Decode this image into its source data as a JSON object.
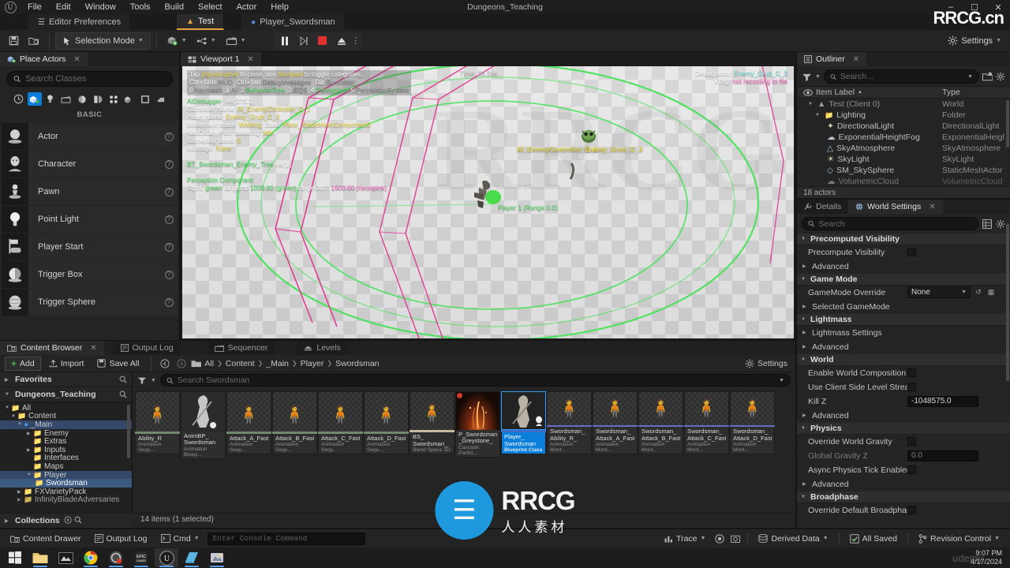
{
  "titlebar": {
    "menu": [
      "File",
      "Edit",
      "Window",
      "Tools",
      "Build",
      "Select",
      "Actor",
      "Help"
    ],
    "project_title": "Dungeons_Teaching",
    "minimize": "–",
    "maximize": "☐",
    "close": "✕"
  },
  "doctabs": [
    {
      "label": "Editor Preferences",
      "icon": "sliders-icon",
      "active": false
    },
    {
      "label": "Test",
      "icon": "level-icon",
      "active": true
    },
    {
      "label": "Player_Swordsman",
      "icon": "blueprint-icon",
      "active": false
    }
  ],
  "toolbar": {
    "save_label": "Save",
    "selection_mode": "Selection Mode",
    "settings": "Settings",
    "items": [
      {
        "name": "save-icon",
        "glyph": "💾"
      },
      {
        "name": "content-icon",
        "glyph": "🗀"
      }
    ]
  },
  "place_actors": {
    "tab_label": "Place Actors",
    "search_placeholder": "Search Classes",
    "categories": [
      {
        "name": "recently-placed-icon",
        "active": false
      },
      {
        "name": "basic-icon",
        "active": true
      },
      {
        "name": "lights-icon",
        "active": false
      },
      {
        "name": "cinematic-icon",
        "active": false
      },
      {
        "name": "visual-effects-icon",
        "active": false
      },
      {
        "name": "geometry-icon",
        "active": false
      },
      {
        "name": "volumes-icon",
        "active": false
      },
      {
        "name": "all-classes-icon",
        "active": false
      },
      {
        "name": "shapes-icon",
        "active": false
      },
      {
        "name": "misc-icon",
        "active": false
      }
    ],
    "section_label": "BASIC",
    "actors": [
      {
        "label": "Actor",
        "icon": "actor-icon"
      },
      {
        "label": "Character",
        "icon": "character-icon"
      },
      {
        "label": "Pawn",
        "icon": "pawn-icon"
      },
      {
        "label": "Point Light",
        "icon": "point-light-icon"
      },
      {
        "label": "Player Start",
        "icon": "player-start-icon"
      },
      {
        "label": "Trigger Box",
        "icon": "trigger-box-icon"
      },
      {
        "label": "Trigger Sphere",
        "icon": "trigger-sphere-icon"
      }
    ],
    "help_glyph": "?"
  },
  "viewport": {
    "tab_label": "Viewport 1",
    "debug_header": [
      {
        "segments": [
          {
            "t": "Tap ",
            "c": "w"
          },
          {
            "t": "[Apostrophe]",
            "c": "y"
          },
          {
            "t": " to close, use ",
            "c": "w"
          },
          {
            "t": "Numpad",
            "c": "y"
          },
          {
            "t": " to toggle categories.",
            "c": "w"
          }
        ]
      },
      {
        "segments": [
          {
            "t": "Ctrl+Tilde",
            "c": "w"
          },
          {
            "t": ":HUD  ",
            "c": "gr"
          },
          {
            "t": "Ctrl+Tab",
            "c": "w"
          },
          {
            "t": ":DebugMessages  ",
            "c": "gr"
          },
          {
            "t": "Tab",
            "c": "w"
          },
          {
            "t": ":Spectator",
            "c": "gr"
          }
        ]
      },
      {
        "segments": [
          {
            "t": "0",
            "c": "w"
          },
          {
            "t": ":Navmesh  ",
            "c": "gr"
          },
          {
            "t": "1",
            "c": "w"
          },
          {
            "t": ":AI  ",
            "c": "gr"
          },
          {
            "t": "2",
            "c": "w"
          },
          {
            "t": ":BehaviorTree  ",
            "c": "g"
          },
          {
            "t": "3",
            "c": "w"
          },
          {
            "t": ":EQS  ",
            "c": "gr"
          },
          {
            "t": "4",
            "c": "w"
          },
          {
            "t": ":Perception  ",
            "c": "g"
          },
          {
            "t": "5",
            "c": "w"
          },
          {
            "t": ":PerceptionSystem",
            "c": "gr"
          }
        ]
      }
    ],
    "debug_ai": [
      {
        "segments": [
          {
            "t": "AIDebugger  ",
            "c": "g"
          },
          {
            "t": "ver[273.1]",
            "c": "w"
          }
        ]
      },
      {
        "segments": [
          {
            "t": "Controller Name: ",
            "c": "w"
          },
          {
            "t": "AI_EnemyController_C_1",
            "c": "y"
          }
        ]
      },
      {
        "segments": [
          {
            "t": "Pawn Name: ",
            "c": "w"
          },
          {
            "t": "Enemy_Grub_C_3",
            "c": "y"
          }
        ]
      },
      {
        "segments": [
          {
            "t": "Movement Mode: ",
            "c": "w"
          },
          {
            "t": "Walking",
            "c": "y"
          },
          {
            "t": ", Base: ",
            "c": "w"
          },
          {
            "t": "Floor_StaticMeshComponent0",
            "c": "y"
          }
        ]
      },
      {
        "segments": [
          {
            "t": "NavData: , Path following: ",
            "c": "w"
          },
          {
            "t": "Idle",
            "c": "y"
          }
        ]
      },
      {
        "segments": [
          {
            "t": "Gameplay tasks: ",
            "c": "w"
          },
          {
            "t": "0",
            "c": "y"
          }
        ]
      },
      {
        "segments": [
          {
            "t": "Montage: ",
            "c": "w"
          },
          {
            "t": "None",
            "c": "y"
          }
        ]
      },
      {
        "segments": [
          {
            "t": "",
            "c": "w"
          }
        ]
      },
      {
        "segments": [
          {
            "t": "BT_Swordsman_Enemy_Tree ",
            "c": "g"
          },
          {
            "t": "ver[1]",
            "c": "w"
          }
        ]
      },
      {
        "segments": [
          {
            "t": "",
            "c": "w"
          }
        ]
      },
      {
        "segments": [
          {
            "t": "Perception Component",
            "c": "g"
          }
        ]
      },
      {
        "segments": [
          {
            "t": "Sight: ",
            "c": "w"
          },
          {
            "t": "green",
            "c": "g"
          },
          {
            "t": " rangeIN: ",
            "c": "w"
          },
          {
            "t": "1000.00 (green)",
            "c": "g"
          },
          {
            "t": " rangeOUT: ",
            "c": "w"
          },
          {
            "t": "1500.00 (neonpink)",
            "c": "p"
          }
        ]
      }
    ],
    "time_label": "Time: 38.24s",
    "debug_actor_label": "Debug actor:",
    "debug_actor_value": "Enemy_Grub_C_3",
    "vlog_label": "VLog:",
    "vlog_value": "not recording to file",
    "actor_tag_controller": "AI_EnemyController_C_1",
    "actor_tag_pawn": "Enemy_Grub_C_3",
    "player_tag": "Player 1 (Range 0.0)"
  },
  "outliner": {
    "tab_label": "Outliner",
    "search_placeholder": "Search...",
    "col_item": "Item Label",
    "col_type": "Type",
    "count": "18 actors",
    "rows": [
      {
        "label": "Test (Client 0)",
        "type": "World",
        "depth": 0,
        "icon": "level-icon",
        "expand": "▼",
        "dim": true
      },
      {
        "label": "Lighting",
        "type": "Folder",
        "depth": 1,
        "icon": "folder-icon",
        "expand": "▼",
        "dim": false
      },
      {
        "label": "DirectionalLight",
        "type": "DirectionalLight",
        "depth": 2,
        "icon": "directional-light-icon",
        "expand": "",
        "dim": false
      },
      {
        "label": "ExponentialHeightFog",
        "type": "ExponentialHeigl",
        "depth": 2,
        "icon": "fog-icon",
        "expand": "",
        "dim": false
      },
      {
        "label": "SkyAtmosphere",
        "type": "SkyAtmosphere",
        "depth": 2,
        "icon": "sky-icon",
        "expand": "",
        "dim": false
      },
      {
        "label": "SkyLight",
        "type": "SkyLight",
        "depth": 2,
        "icon": "skylight-icon",
        "expand": "",
        "dim": false
      },
      {
        "label": "SM_SkySphere",
        "type": "StaticMeshActor",
        "depth": 2,
        "icon": "mesh-icon",
        "expand": "",
        "dim": false
      },
      {
        "label": "VolumetricCloud",
        "type": "VolumetricCloud",
        "depth": 2,
        "icon": "cloud-icon",
        "expand": "",
        "dim": true
      }
    ]
  },
  "details": {
    "tab_details": "Details",
    "tab_world_settings": "World Settings",
    "search_placeholder": "Search",
    "sections": [
      {
        "type": "category",
        "label": "Precomputed Visibility",
        "expanded": true
      },
      {
        "type": "prop",
        "label": "Precompute Visibility",
        "control": "checkbox"
      },
      {
        "type": "subcat",
        "label": "Advanced"
      },
      {
        "type": "category",
        "label": "Game Mode",
        "expanded": true
      },
      {
        "type": "prop",
        "label": "GameMode Override",
        "control": "dropdown",
        "value": "None"
      },
      {
        "type": "subcat",
        "label": "Selected GameMode"
      },
      {
        "type": "category",
        "label": "Lightmass",
        "expanded": true
      },
      {
        "type": "subcat",
        "label": "Lightmass Settings"
      },
      {
        "type": "subcat",
        "label": "Advanced"
      },
      {
        "type": "category",
        "label": "World",
        "expanded": true
      },
      {
        "type": "prop",
        "label": "Enable World Composition",
        "control": "checkbox"
      },
      {
        "type": "prop",
        "label": "Use Client Side Level Streaming...",
        "control": "checkbox"
      },
      {
        "type": "prop",
        "label": "Kill Z",
        "control": "text",
        "value": "-1048575.0"
      },
      {
        "type": "subcat",
        "label": "Advanced"
      },
      {
        "type": "category",
        "label": "Physics",
        "expanded": true
      },
      {
        "type": "prop",
        "label": "Override World Gravity",
        "control": "checkbox"
      },
      {
        "type": "prop",
        "label": "Global Gravity Z",
        "control": "text",
        "value": "0.0",
        "disabled": true
      },
      {
        "type": "prop",
        "label": "Async Physics Tick Enabled",
        "control": "checkbox"
      },
      {
        "type": "subcat",
        "label": "Advanced"
      },
      {
        "type": "category",
        "label": "Broadphase",
        "expanded": true
      },
      {
        "type": "prop",
        "label": "Override Default Broadphase Se...",
        "control": "checkbox"
      }
    ]
  },
  "content_browser": {
    "tabs": [
      {
        "label": "Content Browser",
        "icon": "content-browser-icon",
        "active": true
      },
      {
        "label": "Output Log",
        "icon": "output-log-icon",
        "active": false
      },
      {
        "label": "Sequencer",
        "icon": "sequencer-icon",
        "active": false
      },
      {
        "label": "Levels",
        "icon": "levels-icon",
        "active": false
      }
    ],
    "add_label": "Add",
    "import_label": "Import",
    "save_all_label": "Save All",
    "settings_label": "Settings",
    "breadcrumbs": [
      "All",
      "Content",
      "_Main",
      "Player",
      "Swordsman"
    ],
    "favorites_label": "Favorites",
    "project_label": "Dungeons_Teaching",
    "collections_label": "Collections",
    "search_placeholder": "Search Swordsman",
    "status": "14 items (1 selected)",
    "tree": [
      {
        "label": "All",
        "depth": 0,
        "expand": "▼",
        "icon": "folder-icon"
      },
      {
        "label": "Content",
        "depth": 1,
        "expand": "▼",
        "icon": "folder-icon"
      },
      {
        "label": "_Main",
        "depth": 2,
        "expand": "▼",
        "icon": "sphere-icon",
        "highlight": true
      },
      {
        "label": "Enemy",
        "depth": 3,
        "expand": "▶",
        "icon": "folder-icon"
      },
      {
        "label": "Extras",
        "depth": 3,
        "expand": "",
        "icon": "folder-icon"
      },
      {
        "label": "Inputs",
        "depth": 3,
        "expand": "▶",
        "icon": "folder-icon"
      },
      {
        "label": "Interfaces",
        "depth": 3,
        "expand": "",
        "icon": "folder-icon"
      },
      {
        "label": "Maps",
        "depth": 3,
        "expand": "",
        "icon": "folder-icon"
      },
      {
        "label": "Player",
        "depth": 3,
        "expand": "▼",
        "icon": "folder-icon",
        "highlight": true
      },
      {
        "label": "Swordsman",
        "depth": 4,
        "expand": "",
        "icon": "folder-icon",
        "selected": true
      },
      {
        "label": "FXVarietyPack",
        "depth": 2,
        "expand": "▶",
        "icon": "folder-icon"
      },
      {
        "label": "InfinityBladeAdversaries",
        "depth": 2,
        "expand": "▶",
        "icon": "folder-icon"
      }
    ],
    "assets": [
      {
        "name": "Ability_R",
        "type": "Animation Sequ...",
        "bar": "#6f8a6a",
        "selected": false,
        "thumb": "pose"
      },
      {
        "name": "AnimBP_\nSwordsman",
        "type": "Animation Bluep...",
        "bar": "#8a6a3a",
        "selected": false,
        "thumb": "character"
      },
      {
        "name": "Attack_A_Fast",
        "type": "Animation Sequ...",
        "bar": "#6f8a6a",
        "selected": false,
        "thumb": "pose"
      },
      {
        "name": "Attack_B_Fast",
        "type": "Animation Sequ...",
        "bar": "#6f8a6a",
        "selected": false,
        "thumb": "pose"
      },
      {
        "name": "Attack_C_Fast",
        "type": "Animation Sequ...",
        "bar": "#6f8a6a",
        "selected": false,
        "thumb": "pose"
      },
      {
        "name": "Attack_D_Fast",
        "type": "Animation Sequ...",
        "bar": "#6f8a6a",
        "selected": false,
        "thumb": "pose"
      },
      {
        "name": "BS_\nSwordsman_",
        "type": "Blend Space 1D",
        "bar": "#c9b9a0",
        "selected": false,
        "thumb": "pose"
      },
      {
        "name": "P_Swordsman\n_Greystone_",
        "type": "Cascade Particl...",
        "bar": "#c9c9c9",
        "selected": false,
        "thumb": "fx"
      },
      {
        "name": "Player_\nSwordsman",
        "type": "Blueprint Class",
        "bar": "#3b6ec2",
        "selected": true,
        "thumb": "character"
      },
      {
        "name": "Swordsman_\nAbility_R_",
        "type": "Animation Mont...",
        "bar": "#6a6ac2",
        "selected": false,
        "thumb": "pose"
      },
      {
        "name": "Swordsman_\nAttack_A_Fast",
        "type": "Animation Mont...",
        "bar": "#6a6ac2",
        "selected": false,
        "thumb": "pose"
      },
      {
        "name": "Swordsman_\nAttack_B_Fast",
        "type": "Animation Mont...",
        "bar": "#6a6ac2",
        "selected": false,
        "thumb": "pose"
      },
      {
        "name": "Swordsman_\nAttack_C_Fast",
        "type": "Animation Mont...",
        "bar": "#6a6ac2",
        "selected": false,
        "thumb": "pose"
      },
      {
        "name": "Swordsman_\nAttack_D_Fast",
        "type": "Animation Mont...",
        "bar": "#6a6ac2",
        "selected": false,
        "thumb": "pose"
      }
    ]
  },
  "statusbar": {
    "content_drawer": "Content Drawer",
    "output_log": "Output Log",
    "cmd_label": "Cmd",
    "console_placeholder": "Enter Console Command",
    "trace": "Trace",
    "derived_data": "Derived Data",
    "all_saved": "All Saved",
    "revision_control": "Revision Control"
  },
  "taskbar": {
    "icons": [
      {
        "name": "windows-start-icon",
        "active": false
      },
      {
        "name": "file-explorer-icon",
        "active": false
      },
      {
        "name": "media-icon",
        "active": false
      },
      {
        "name": "chrome-icon",
        "active": false
      },
      {
        "name": "recorder-icon",
        "active": false
      },
      {
        "name": "epic-games-icon",
        "active": false
      },
      {
        "name": "unreal-engine-icon",
        "active": true
      },
      {
        "name": "notes-icon",
        "active": false
      },
      {
        "name": "photos-icon",
        "active": false
      }
    ],
    "time": "9:07 PM",
    "date": "4/17/2024"
  },
  "watermarks": {
    "rrcg_top": "RRCG.cn",
    "center_latin": "RRCG",
    "center_cn": "人人素材",
    "udemy": "udemy"
  },
  "colors": {
    "accent_blue": "#0b7ddb",
    "orange_tab": "#e8a33d",
    "green_debug": "#57e06a",
    "yellow_debug": "#f2e14c",
    "pink_debug": "#ff6ec7",
    "panel_bg": "#242424"
  }
}
